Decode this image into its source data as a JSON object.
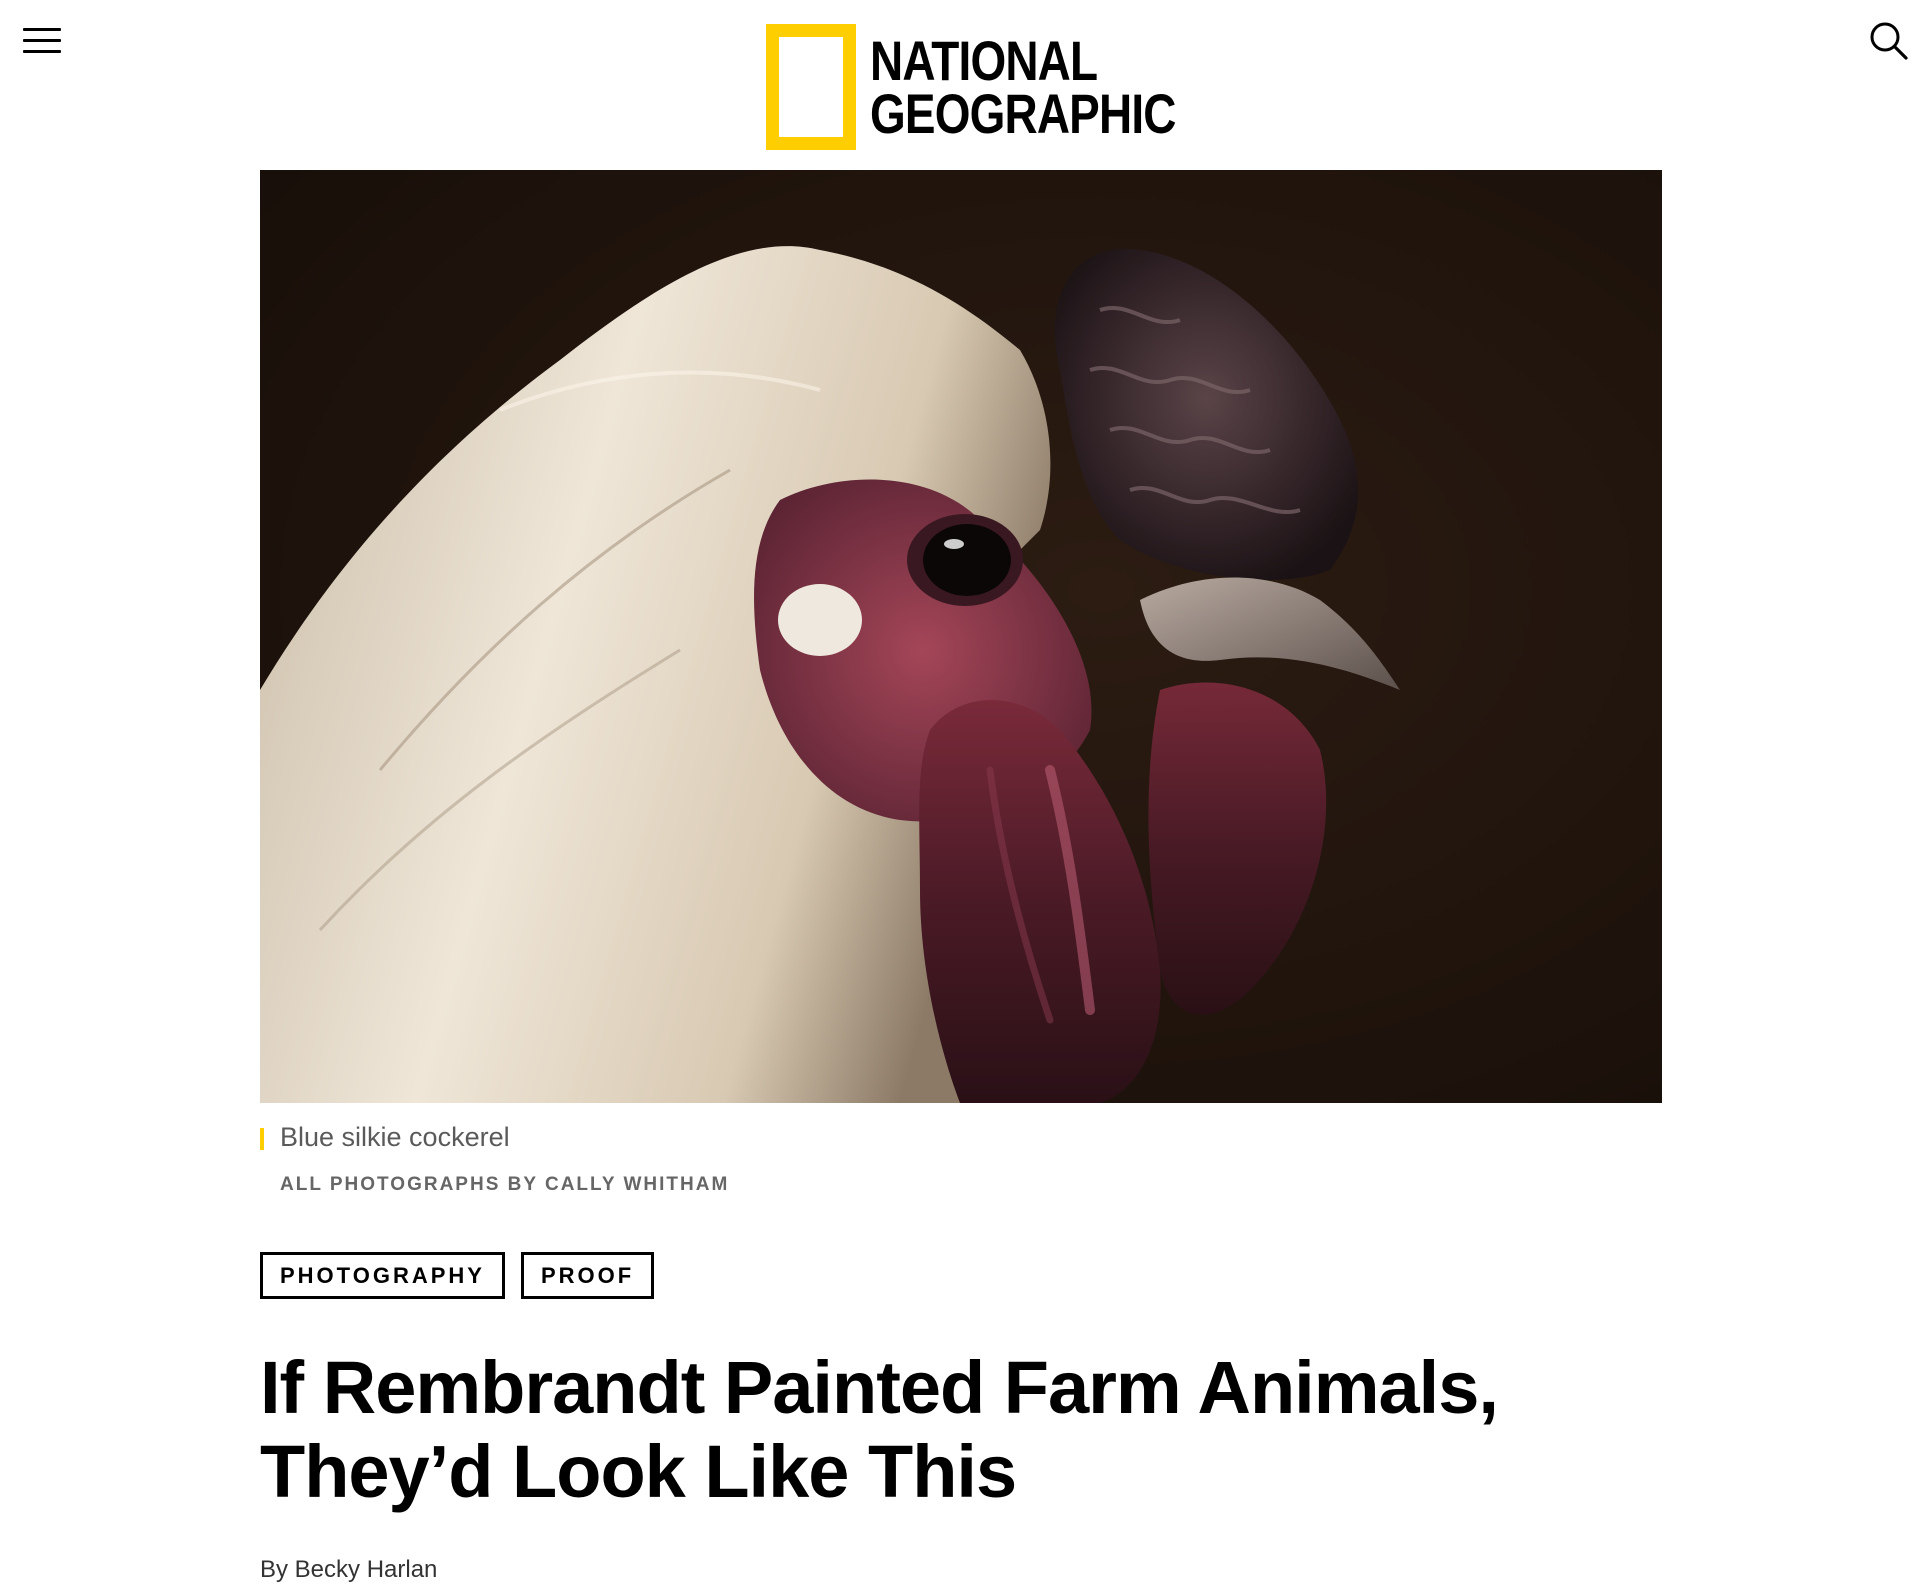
{
  "header": {
    "brand_line1": "NATIONAL",
    "brand_line2": "GEOGRAPHIC",
    "menu_icon": "hamburger-menu-icon",
    "search_icon": "search-icon",
    "brand_color": "#ffce00"
  },
  "hero": {
    "alt": "Blue silkie cockerel"
  },
  "caption": {
    "text": "Blue silkie cockerel",
    "credit": "ALL PHOTOGRAPHS BY CALLY WHITHAM"
  },
  "tags": [
    "PHOTOGRAPHY",
    "PROOF"
  ],
  "article": {
    "headline": "If Rembrandt Painted Farm Animals, They’d Look Like This",
    "byline": "By Becky Harlan"
  }
}
